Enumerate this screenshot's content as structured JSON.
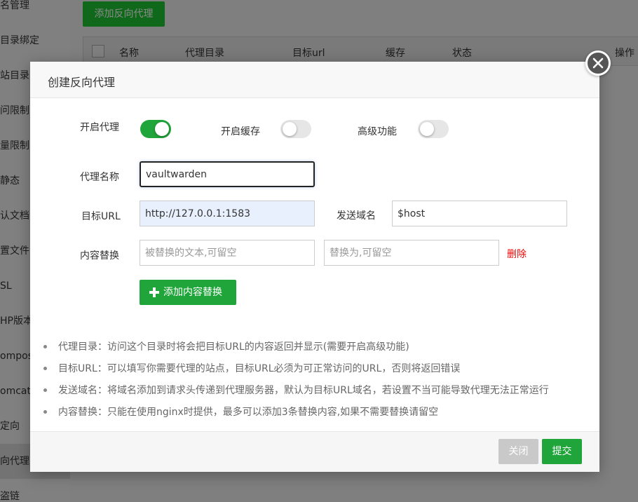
{
  "background": {
    "sidebar_items": [
      "名管理",
      "目录绑定",
      "站目录",
      "问限制",
      "量限制",
      "静态",
      "认文档",
      "置文件",
      "SL",
      "HP版本",
      "ompos",
      "omcat",
      "定向",
      "向代理",
      "盗链"
    ],
    "add_button_label": "添加反向代理",
    "table_columns": [
      "名称",
      "代理目录",
      "目标url",
      "缓存",
      "状态",
      "操作"
    ]
  },
  "modal": {
    "title": "创建反向代理",
    "toggles": {
      "enable_proxy": {
        "label": "开启代理",
        "on": true
      },
      "enable_cache": {
        "label": "开启缓存",
        "on": false
      },
      "advanced": {
        "label": "高级功能",
        "on": false
      }
    },
    "proxy_name": {
      "label": "代理名称",
      "value": "vaultwarden"
    },
    "target_url": {
      "label": "目标URL",
      "value": "http://127.0.0.1:1583"
    },
    "send_domain": {
      "label": "发送域名",
      "value": "$host"
    },
    "content_replace": {
      "label": "内容替换",
      "from_placeholder": "被替换的文本,可留空",
      "to_placeholder": "替换为,可留空",
      "delete_label": "删除"
    },
    "add_content_replace_label": "添加内容替换",
    "tips": [
      "代理目录：访问这个目录时将会把目标URL的内容返回并显示(需要开启高级功能)",
      "目标URL：可以填写你需要代理的站点，目标URL必须为可正常访问的URL，否则将返回错误",
      "发送域名：将域名添加到请求头传递到代理服务器，默认为目标URL域名，若设置不当可能导致代理无法正常运行",
      "内容替换：只能在使用nginx时提供，最多可以添加3条替换内容,如果不需要替换请留空"
    ],
    "buttons": {
      "close": "关闭",
      "submit": "提交"
    }
  },
  "colors": {
    "accent": "#20a53a",
    "danger": "#ef0808",
    "overlay": "#7f7f7f"
  }
}
